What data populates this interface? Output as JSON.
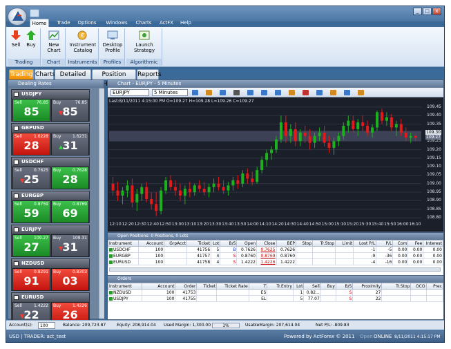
{
  "window": {
    "menus": [
      "Home",
      "Trade",
      "Options",
      "Windows",
      "Charts",
      "ActFX",
      "Help"
    ],
    "controls": {
      "minimize": "_",
      "maximize": "□",
      "close": "x"
    }
  },
  "ribbon": {
    "groups": [
      {
        "name": "Trading",
        "buttons": [
          {
            "label": "Sell",
            "icon": "sell-arrow-icon"
          },
          {
            "label": "Buy",
            "icon": "buy-arrow-icon"
          }
        ]
      },
      {
        "name": "Chart",
        "buttons": [
          {
            "label": "New Chart",
            "icon": "chart-icon"
          }
        ]
      },
      {
        "name": "Instruments",
        "buttons": [
          {
            "label": "Instrument Catalog",
            "icon": "catalog-icon"
          }
        ]
      },
      {
        "name": "Profiles",
        "buttons": [
          {
            "label": "Desktop Profile",
            "icon": "profile-icon"
          }
        ]
      },
      {
        "name": "Algorithmic Trading",
        "buttons": [
          {
            "label": "Launch Strategy",
            "icon": "strategy-icon"
          }
        ]
      }
    ]
  },
  "tabs": [
    "Trading",
    "Charts",
    "Detailed Info",
    "Position History",
    "Reports"
  ],
  "dealing": {
    "title": "Dealing Rates",
    "cards": [
      {
        "symbol": "USDJPY",
        "sell_label": "Sell",
        "sell_rate": "76.85",
        "sell_big": "85",
        "buy_label": "Buy",
        "buy_rate": "76.85",
        "buy_big": "85",
        "sell_color": "green",
        "buy_color": "gray",
        "sell_arrow": "",
        "buy_arrow": "down"
      },
      {
        "symbol": "GBPUSD",
        "sell_label": "Sell",
        "sell_rate": "1.6228",
        "sell_big": "28",
        "buy_label": "Buy",
        "buy_rate": "1.6231",
        "buy_big": "31",
        "sell_color": "red",
        "buy_color": "gray",
        "sell_arrow": "",
        "buy_arrow": "up"
      },
      {
        "symbol": "USDCHF",
        "sell_label": "Sell",
        "sell_rate": "0.7625",
        "sell_big": "25",
        "buy_label": "Buy",
        "buy_rate": "0.7628",
        "buy_big": "28",
        "sell_color": "gray",
        "buy_color": "green",
        "sell_arrow": "down",
        "buy_arrow": ""
      },
      {
        "symbol": "EURGBP",
        "sell_label": "Sell",
        "sell_rate": "0.8759",
        "sell_big": "59",
        "buy_label": "Buy",
        "buy_rate": "0.8769",
        "buy_big": "69",
        "sell_color": "green",
        "buy_color": "green",
        "sell_arrow": "",
        "buy_arrow": ""
      },
      {
        "symbol": "EURJPY",
        "sell_label": "Sell",
        "sell_rate": "109.27",
        "sell_big": "27",
        "buy_label": "Buy",
        "buy_rate": "109.31",
        "buy_big": "31",
        "sell_color": "green",
        "buy_color": "gray",
        "sell_arrow": "",
        "buy_arrow": "down"
      },
      {
        "symbol": "NZDUSD",
        "sell_label": "Sell",
        "sell_rate": "0.8291",
        "sell_big": "91",
        "buy_label": "Buy",
        "buy_rate": "0.8303",
        "buy_big": "03",
        "sell_color": "red",
        "buy_color": "red",
        "sell_arrow": "",
        "buy_arrow": ""
      },
      {
        "symbol": "EURUSD",
        "sell_label": "Sell",
        "sell_rate": "1.4222",
        "sell_big": "22",
        "buy_label": "Buy",
        "buy_rate": "1.4226",
        "buy_big": "26",
        "sell_color": "gray",
        "buy_color": "red",
        "sell_arrow": "down",
        "buy_arrow": ""
      }
    ]
  },
  "chart": {
    "title": "Chart - EURJPY - 5 Minutes",
    "instrument": "EURJPY",
    "timeframe": "5 Minutes",
    "ohlc_text": "Last:8/11/2011 4:15:00 PM O=109.27 H=109.28 L=109.26 C=109.27"
  },
  "chart_data": {
    "type": "candlestick",
    "title": "Chart - EURJPY - 5 Minutes",
    "x_ticks": [
      "12:10",
      "12:20",
      "12:30",
      "12:40",
      "12:50",
      "13:00",
      "13:10",
      "13:20",
      "13:30",
      "13:40",
      "13:50",
      "14:00",
      "14:10",
      "14:20",
      "14:30",
      "14:40",
      "14:50",
      "15:00",
      "15:10",
      "15:20",
      "15:30",
      "15:40",
      "15:50",
      "16:00",
      "16:10"
    ],
    "y_ticks": [
      "109.45",
      "109.40",
      "109.35",
      "109.30",
      "109.25",
      "109.20",
      "109.15",
      "109.10",
      "109.05",
      "109.00",
      "108.95",
      "108.90",
      "108.85",
      "108.80"
    ],
    "ylim": [
      108.78,
      109.47
    ],
    "current_price": "109.27",
    "bid_label": "109.30",
    "candles": [
      {
        "o": 109.0,
        "h": 109.04,
        "l": 108.93,
        "c": 108.96
      },
      {
        "o": 108.96,
        "h": 109.01,
        "l": 108.9,
        "c": 108.93
      },
      {
        "o": 108.93,
        "h": 108.98,
        "l": 108.88,
        "c": 108.96
      },
      {
        "o": 108.96,
        "h": 109.02,
        "l": 108.92,
        "c": 108.99
      },
      {
        "o": 108.99,
        "h": 109.03,
        "l": 108.86,
        "c": 108.89
      },
      {
        "o": 108.89,
        "h": 108.97,
        "l": 108.84,
        "c": 108.94
      },
      {
        "o": 108.94,
        "h": 109.0,
        "l": 108.9,
        "c": 108.98
      },
      {
        "o": 108.98,
        "h": 109.01,
        "l": 108.89,
        "c": 108.91
      },
      {
        "o": 108.91,
        "h": 108.95,
        "l": 108.85,
        "c": 108.88
      },
      {
        "o": 108.88,
        "h": 108.95,
        "l": 108.81,
        "c": 108.84
      },
      {
        "o": 108.84,
        "h": 108.98,
        "l": 108.82,
        "c": 108.96
      },
      {
        "o": 108.96,
        "h": 109.04,
        "l": 108.94,
        "c": 109.02
      },
      {
        "o": 109.02,
        "h": 109.05,
        "l": 108.96,
        "c": 108.98
      },
      {
        "o": 108.98,
        "h": 109.02,
        "l": 108.93,
        "c": 108.96
      },
      {
        "o": 108.96,
        "h": 109.0,
        "l": 108.9,
        "c": 108.93
      },
      {
        "o": 108.93,
        "h": 108.99,
        "l": 108.88,
        "c": 108.97
      },
      {
        "o": 108.97,
        "h": 109.01,
        "l": 108.92,
        "c": 108.95
      },
      {
        "o": 108.95,
        "h": 109.0,
        "l": 108.93,
        "c": 108.99
      },
      {
        "o": 108.99,
        "h": 109.02,
        "l": 108.95,
        "c": 108.97
      },
      {
        "o": 108.97,
        "h": 109.01,
        "l": 108.93,
        "c": 108.95
      },
      {
        "o": 108.95,
        "h": 109.0,
        "l": 108.92,
        "c": 108.98
      },
      {
        "o": 108.98,
        "h": 109.03,
        "l": 108.95,
        "c": 109.0
      },
      {
        "o": 109.0,
        "h": 109.04,
        "l": 108.96,
        "c": 108.98
      },
      {
        "o": 108.98,
        "h": 109.02,
        "l": 108.94,
        "c": 108.96
      },
      {
        "o": 108.96,
        "h": 109.01,
        "l": 108.93,
        "c": 108.99
      },
      {
        "o": 108.99,
        "h": 109.04,
        "l": 108.96,
        "c": 109.02
      },
      {
        "o": 109.02,
        "h": 109.05,
        "l": 108.97,
        "c": 109.0
      },
      {
        "o": 109.0,
        "h": 109.08,
        "l": 108.98,
        "c": 109.06
      },
      {
        "o": 109.06,
        "h": 109.09,
        "l": 109.0,
        "c": 109.03
      },
      {
        "o": 109.03,
        "h": 109.07,
        "l": 108.99,
        "c": 109.01
      },
      {
        "o": 109.01,
        "h": 109.1,
        "l": 109.0,
        "c": 109.08
      },
      {
        "o": 109.08,
        "h": 109.16,
        "l": 109.06,
        "c": 109.14
      },
      {
        "o": 109.14,
        "h": 109.2,
        "l": 109.1,
        "c": 109.18
      },
      {
        "o": 109.18,
        "h": 109.22,
        "l": 109.14,
        "c": 109.2
      },
      {
        "o": 109.2,
        "h": 109.28,
        "l": 109.18,
        "c": 109.26
      },
      {
        "o": 109.26,
        "h": 109.4,
        "l": 109.24,
        "c": 109.36
      },
      {
        "o": 109.36,
        "h": 109.4,
        "l": 109.24,
        "c": 109.28
      },
      {
        "o": 109.28,
        "h": 109.35,
        "l": 109.24,
        "c": 109.32
      },
      {
        "o": 109.32,
        "h": 109.36,
        "l": 109.22,
        "c": 109.25
      },
      {
        "o": 109.25,
        "h": 109.32,
        "l": 109.22,
        "c": 109.3
      },
      {
        "o": 109.3,
        "h": 109.34,
        "l": 109.24,
        "c": 109.28
      },
      {
        "o": 109.28,
        "h": 109.32,
        "l": 109.2,
        "c": 109.24
      },
      {
        "o": 109.24,
        "h": 109.3,
        "l": 109.21,
        "c": 109.28
      },
      {
        "o": 109.28,
        "h": 109.33,
        "l": 109.25,
        "c": 109.3
      },
      {
        "o": 109.3,
        "h": 109.34,
        "l": 109.22,
        "c": 109.24
      },
      {
        "o": 109.24,
        "h": 109.28,
        "l": 109.18,
        "c": 109.21
      },
      {
        "o": 109.21,
        "h": 109.27,
        "l": 109.17,
        "c": 109.25
      },
      {
        "o": 109.25,
        "h": 109.3,
        "l": 109.22,
        "c": 109.28
      },
      {
        "o": 109.28,
        "h": 109.36,
        "l": 109.26,
        "c": 109.34
      },
      {
        "o": 109.34,
        "h": 109.4,
        "l": 109.3,
        "c": 109.37
      },
      {
        "o": 109.37,
        "h": 109.4,
        "l": 109.3,
        "c": 109.32
      },
      {
        "o": 109.32,
        "h": 109.38,
        "l": 109.28,
        "c": 109.36
      },
      {
        "o": 109.36,
        "h": 109.4,
        "l": 109.31,
        "c": 109.34
      },
      {
        "o": 109.34,
        "h": 109.37,
        "l": 109.28,
        "c": 109.3
      },
      {
        "o": 109.3,
        "h": 109.35,
        "l": 109.27,
        "c": 109.33
      },
      {
        "o": 109.33,
        "h": 109.43,
        "l": 109.31,
        "c": 109.42
      },
      {
        "o": 109.42,
        "h": 109.44,
        "l": 109.35,
        "c": 109.37
      },
      {
        "o": 109.37,
        "h": 109.42,
        "l": 109.34,
        "c": 109.39
      },
      {
        "o": 109.39,
        "h": 109.41,
        "l": 109.31,
        "c": 109.33
      },
      {
        "o": 109.33,
        "h": 109.37,
        "l": 109.28,
        "c": 109.35
      },
      {
        "o": 109.35,
        "h": 109.38,
        "l": 109.28,
        "c": 109.3
      },
      {
        "o": 109.3,
        "h": 109.33,
        "l": 109.25,
        "c": 109.27
      },
      {
        "o": 109.27,
        "h": 109.3,
        "l": 109.24,
        "c": 109.28
      },
      {
        "o": 109.28,
        "h": 109.29,
        "l": 109.25,
        "c": 109.27
      }
    ]
  },
  "positions": {
    "title": "Open Positions: 0 Positions, 0 Lots",
    "columns": [
      "Instrument",
      "Account",
      "GrpAcct",
      "Ticket",
      "Lot",
      "B/S",
      "Open",
      "Close",
      "BEP",
      "Stop",
      "Tr.Stop",
      "Limit",
      "Lost P/L",
      "P/L",
      "Com",
      "Fee",
      "Interest"
    ],
    "rows": [
      [
        "USDCHF",
        "100",
        "",
        "41756",
        "5",
        "B",
        "0.7626",
        "0.7625",
        "0.7626",
        "",
        "",
        "",
        "-1",
        "-5",
        "0.00",
        "0.00",
        "0.00"
      ],
      [
        "EURGBP",
        "100",
        "",
        "41757",
        "4",
        "S",
        "0.8760",
        "0.8769",
        "0.8760",
        "",
        "",
        "",
        "-9",
        "-36",
        "0.00",
        "0.00",
        "0.00"
      ],
      [
        "EURUSD",
        "100",
        "",
        "41758",
        "4",
        "S",
        "1.4222",
        "1.4226",
        "1.4222",
        "",
        "",
        "",
        "-4",
        "-16",
        "0.00",
        "0.00",
        "0.00"
      ]
    ]
  },
  "orders": {
    "title": "Orders",
    "columns": [
      "Instrument",
      "Account",
      "Order",
      "Ticket",
      "Ticket Rate",
      "T",
      "Tr.Entry",
      "Lot",
      "Sell",
      "Buy",
      "B/S",
      "Proximity",
      "Tr.Stop",
      "OCO",
      "Prec"
    ],
    "rows": [
      [
        "NZDUSD",
        "100",
        "41753",
        "",
        "",
        "ES",
        "",
        "1",
        "0.82...",
        "",
        "S",
        "27",
        "",
        "",
        ""
      ],
      [
        "USDJPY",
        "100",
        "41755",
        "",
        "",
        "EL",
        "",
        "5",
        "77.07",
        "",
        "S",
        "22",
        "",
        "",
        ""
      ]
    ]
  },
  "account_bar": {
    "account_label": "Account(s):",
    "account_value": "100",
    "balance": "Balance: 209,723.87",
    "equity": "Equity: 208,914.04",
    "used_margin": "Used Margin: 1,300.00",
    "margin_pct": "1%",
    "usable_margin": "UsableMargin: 207,614.04",
    "net_pl": "Net P/L: -809.83"
  },
  "status_bar": {
    "left": "USD | TRADER: act_test",
    "powered": "Powered by ActForex © 2011",
    "open": "Open",
    "online": "ONLINE",
    "datetime": "8/11/2011 4:15:17 PM"
  },
  "colors": {
    "sell_green": "#1a8a25",
    "sell_red": "#c3140e",
    "bull": "#1db21d",
    "bear": "#e21a1a",
    "chart_bg": "#1b1f2a"
  }
}
